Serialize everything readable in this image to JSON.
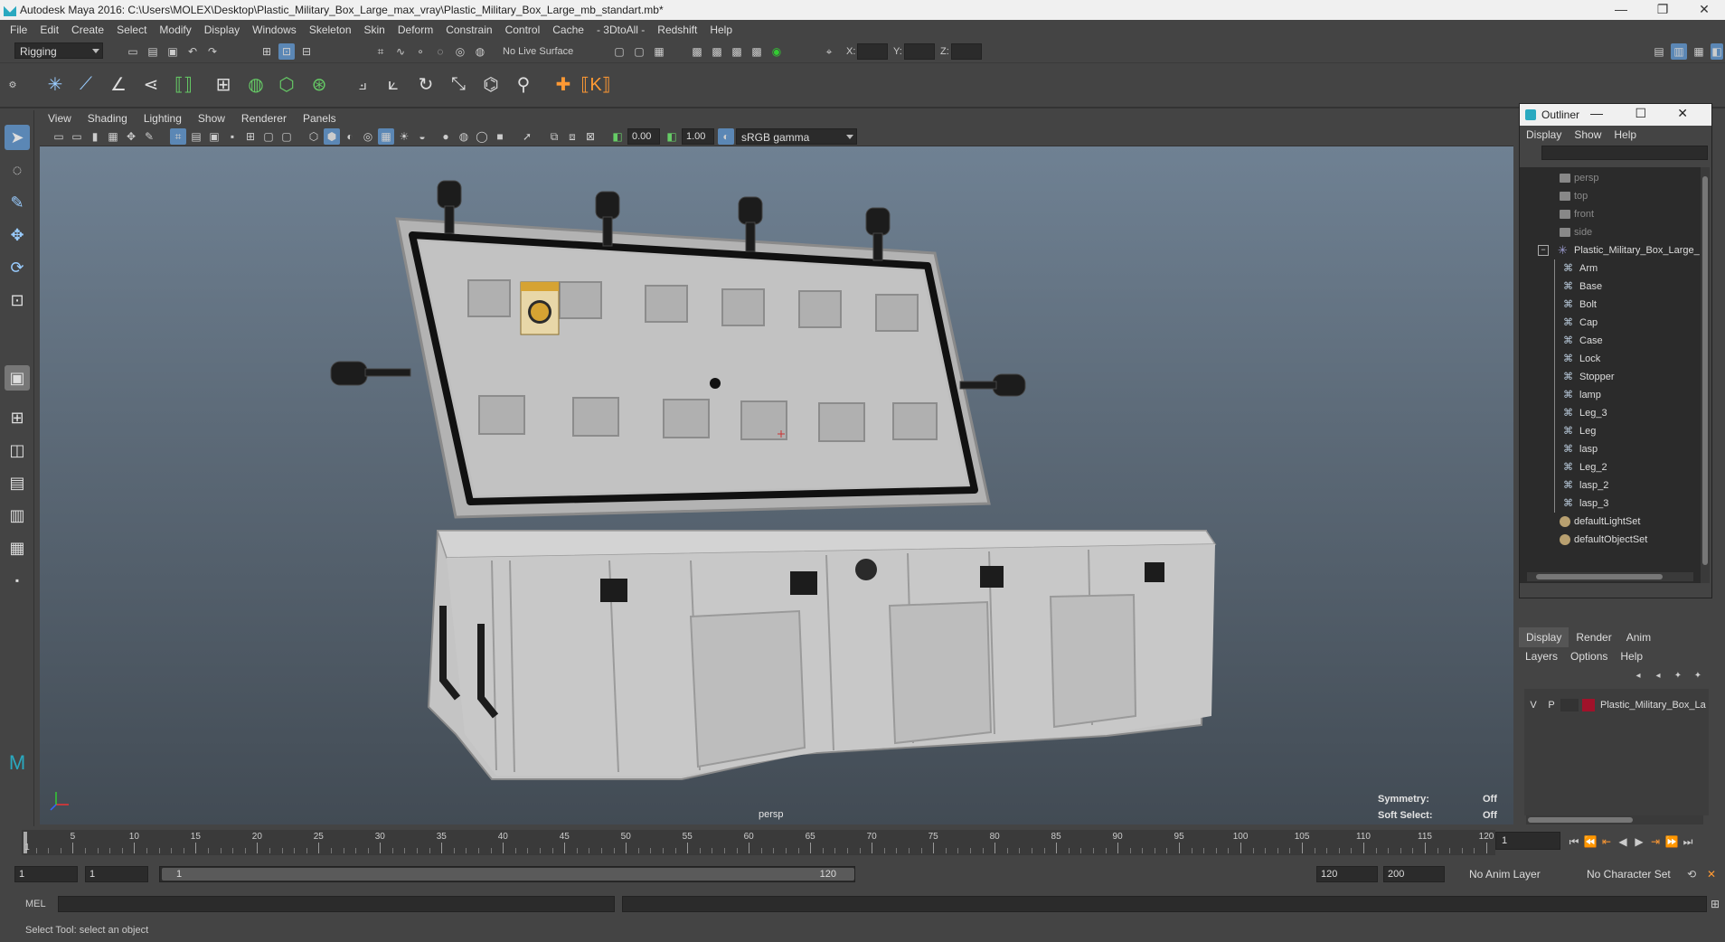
{
  "window": {
    "title": "Autodesk Maya 2016: C:\\Users\\MOLEX\\Desktop\\Plastic_Military_Box_Large_max_vray\\Plastic_Military_Box_Large_mb_standart.mb*",
    "minimize": "—",
    "restore": "❐",
    "close": "✕"
  },
  "menubar": [
    "File",
    "Edit",
    "Create",
    "Select",
    "Modify",
    "Display",
    "Windows",
    "Skeleton",
    "Skin",
    "Deform",
    "Constrain",
    "Control",
    "Cache",
    "- 3DtoAll -",
    "Redshift",
    "Help"
  ],
  "statusline": {
    "mode": "Rigging",
    "live_surface": "No Live Surface",
    "x_label": "X:",
    "y_label": "Y:",
    "z_label": "Z:"
  },
  "viewport": {
    "menu": [
      "View",
      "Shading",
      "Lighting",
      "Show",
      "Renderer",
      "Panels"
    ],
    "exposure": "0.00",
    "gamma": "1.00",
    "color_space": "sRGB gamma",
    "camera_label": "persp",
    "symmetry_label": "Symmetry:",
    "symmetry_value": "Off",
    "soft_select_label": "Soft Select:",
    "soft_select_value": "Off"
  },
  "outliner": {
    "title": "Outliner",
    "menu": [
      "Display",
      "Show",
      "Help"
    ],
    "cameras": [
      "persp",
      "top",
      "front",
      "side"
    ],
    "root": "Plastic_Military_Box_Large_",
    "children": [
      "Arm",
      "Base",
      "Bolt",
      "Cap",
      "Case",
      "Lock",
      "Stopper",
      "lamp",
      "Leg_3",
      "Leg",
      "lasp",
      "Leg_2",
      "lasp_2",
      "lasp_3"
    ],
    "sets": [
      "defaultLightSet",
      "defaultObjectSet"
    ]
  },
  "layer_editor": {
    "tabs": [
      "Display",
      "Render",
      "Anim"
    ],
    "menu": [
      "Layers",
      "Options",
      "Help"
    ],
    "layer": {
      "v": "V",
      "p": "P",
      "name": "Plastic_Military_Box_La",
      "color": "#a0122a"
    }
  },
  "timeline": {
    "ticks": [
      "5",
      "10",
      "15",
      "20",
      "25",
      "30",
      "35",
      "40",
      "45",
      "50",
      "55",
      "60",
      "65",
      "70",
      "75",
      "80",
      "85",
      "90",
      "95",
      "100",
      "105",
      "110",
      "115",
      "120"
    ],
    "start_marker": "1",
    "current_frame": "1"
  },
  "range": {
    "start": "1",
    "start2": "1",
    "thumb_start": "1",
    "thumb_end": "120",
    "end": "120",
    "end2": "200",
    "anim_layer": "No Anim Layer",
    "character_set": "No Character Set"
  },
  "cmdline": {
    "lang": "MEL"
  },
  "helpline": {
    "text": "Select Tool: select an object"
  },
  "colors": {
    "accent": "#5b87b5",
    "layer": "#a0122a"
  }
}
